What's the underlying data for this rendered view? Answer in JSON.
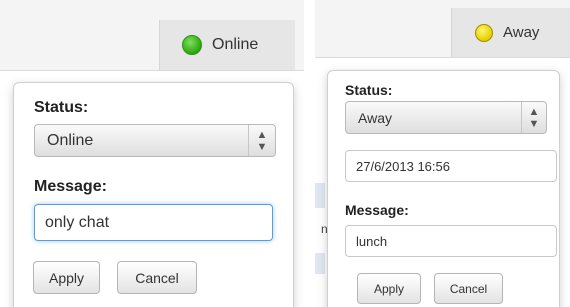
{
  "left": {
    "current_status": "Online",
    "status_label": "Status:",
    "status_value": "Online",
    "message_label": "Message:",
    "message_value": "only chat",
    "apply_label": "Apply",
    "cancel_label": "Cancel",
    "status_color": "#3cb516"
  },
  "right": {
    "current_status": "Away",
    "status_label": "Status:",
    "status_value": "Away",
    "datetime_value": "27/6/2013 16:56",
    "message_label": "Message:",
    "message_value": "lunch",
    "apply_label": "Apply",
    "cancel_label": "Cancel",
    "status_color": "#ead800",
    "partial_background_text": "n"
  }
}
